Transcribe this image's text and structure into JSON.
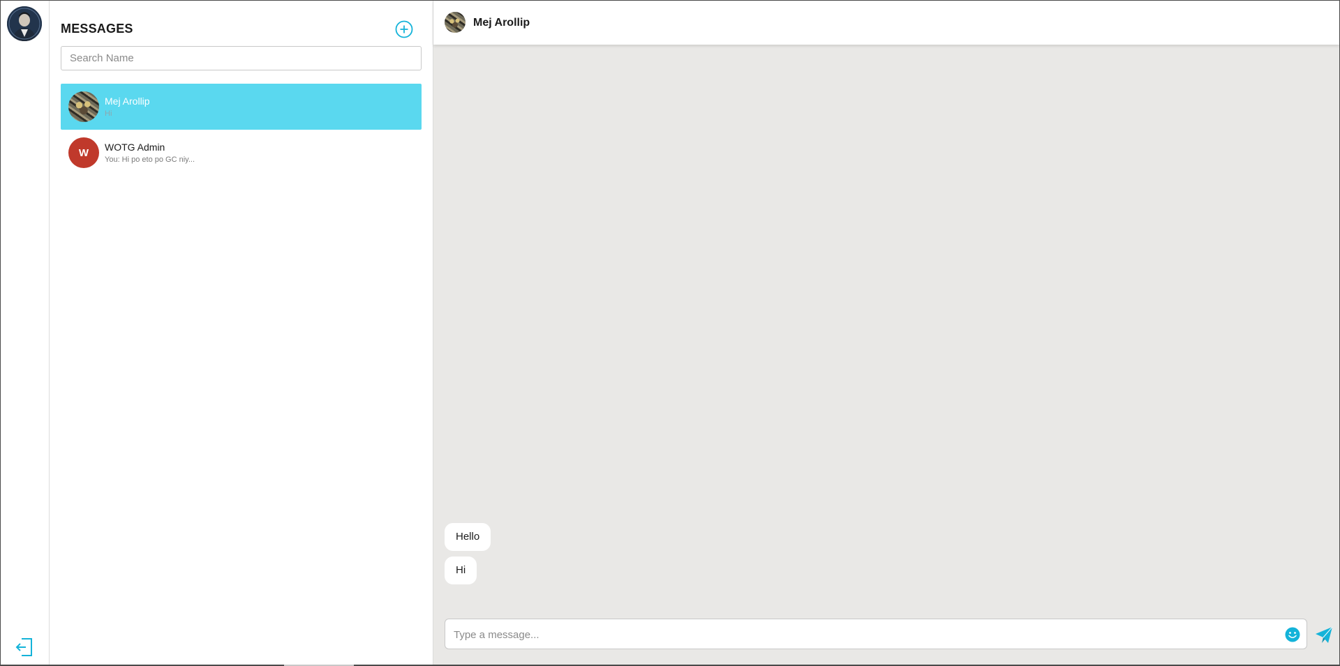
{
  "sidebar": {
    "profile_avatar": "profile-photo",
    "logout_icon": "logout-icon"
  },
  "conversations_panel": {
    "title": "MESSAGES",
    "new_chat_icon": "plus-circle-icon",
    "search": {
      "placeholder": "Search Name",
      "value": ""
    },
    "items": [
      {
        "name": "Mej Arollip",
        "preview": "Hi",
        "avatar": "cat-photo",
        "active": true
      },
      {
        "name": "WOTG Admin",
        "preview": "You: Hi po eto po GC niy...",
        "avatar_letter": "W",
        "active": false
      }
    ]
  },
  "chat": {
    "header_name": "Mej Arollip",
    "messages": [
      {
        "text": "Hello"
      },
      {
        "text": "Hi"
      }
    ],
    "composer": {
      "placeholder": "Type a message...",
      "value": "",
      "emoji_icon": "smiley-icon",
      "send_icon": "paper-plane-icon"
    }
  },
  "colors": {
    "accent": "#14b3d9",
    "active_item": "#5ad8ef",
    "chat_background": "#e9e8e6",
    "letter_avatar": "#c0392b"
  }
}
